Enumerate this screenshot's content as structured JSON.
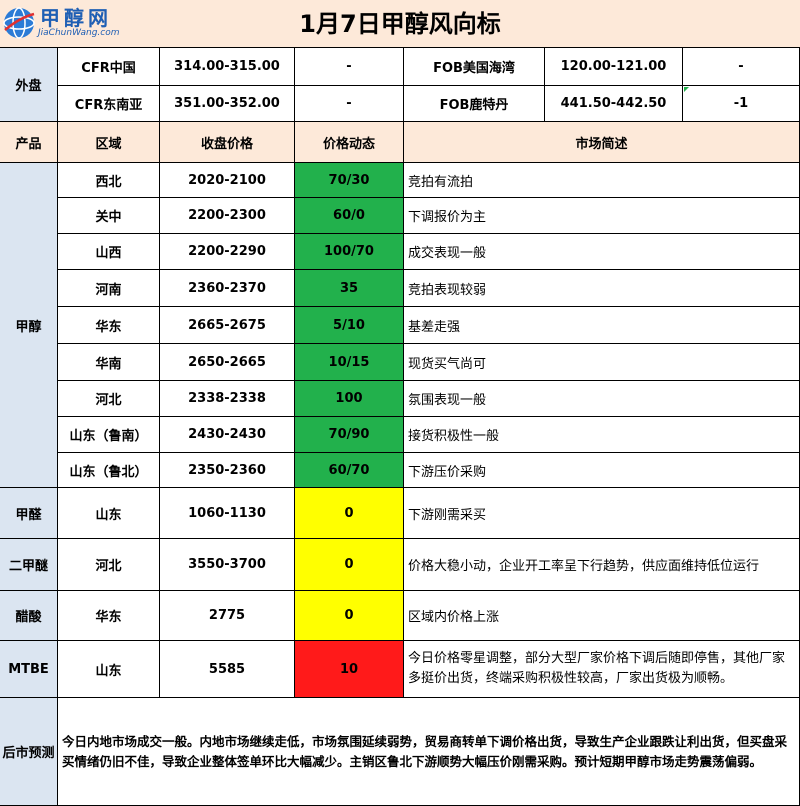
{
  "title_bar": {
    "logo_text": "甲醇网",
    "logo_url": "JiaChunWang.com",
    "title": "1月7日甲醇风向标"
  },
  "foreign": {
    "label": "外盘",
    "rows": [
      {
        "left_name": "CFR中国",
        "left_price": "314.00-315.00",
        "left_change": "-",
        "right_name": "FOB美国海湾",
        "right_price": "120.00-121.00",
        "right_change": "-"
      },
      {
        "left_name": "CFR东南亚",
        "left_price": "351.00-352.00",
        "left_change": "-",
        "right_name": "FOB鹿特丹",
        "right_price": "441.50-442.50",
        "right_change": "-1"
      }
    ]
  },
  "header": {
    "product": "产品",
    "region": "区域",
    "close_price": "收盘价格",
    "price_change": "价格动态",
    "market_desc": "市场简述"
  },
  "groups": [
    {
      "product": "甲醇",
      "rows": [
        {
          "region": "西北",
          "price": "2020-2100",
          "change": "70/30",
          "color": "#22b14c",
          "desc": "竞拍有流拍"
        },
        {
          "region": "关中",
          "price": "2200-2300",
          "change": "60/0",
          "color": "#22b14c",
          "desc": "下调报价为主"
        },
        {
          "region": "山西",
          "price": "2200-2290",
          "change": "100/70",
          "color": "#22b14c",
          "desc": "成交表现一般"
        },
        {
          "region": "河南",
          "price": "2360-2370",
          "change": "35",
          "color": "#22b14c",
          "desc": "竞拍表现较弱"
        },
        {
          "region": "华东",
          "price": "2665-2675",
          "change": "5/10",
          "color": "#22b14c",
          "desc": "基差走强"
        },
        {
          "region": "华南",
          "price": "2650-2665",
          "change": "10/15",
          "color": "#22b14c",
          "desc": "现货买气尚可"
        },
        {
          "region": "河北",
          "price": "2338-2338",
          "change": "100",
          "color": "#22b14c",
          "desc": "氛围表现一般"
        },
        {
          "region": "山东（鲁南）",
          "price": "2430-2430",
          "change": "70/90",
          "color": "#22b14c",
          "desc": "接货积极性一般"
        },
        {
          "region": "山东（鲁北）",
          "price": "2350-2360",
          "change": "60/70",
          "color": "#22b14c",
          "desc": "下游压价采购"
        }
      ]
    },
    {
      "product": "甲醛",
      "rows": [
        {
          "region": "山东",
          "price": "1060-1130",
          "change": "0",
          "color": "#ffff00",
          "desc": "下游刚需采买"
        }
      ]
    },
    {
      "product": "二甲醚",
      "rows": [
        {
          "region": "河北",
          "price": "3550-3700",
          "change": "0",
          "color": "#ffff00",
          "desc": "价格大稳小动，企业开工率呈下行趋势，供应面维持低位运行"
        }
      ]
    },
    {
      "product": "醋酸",
      "rows": [
        {
          "region": "华东",
          "price": "2775",
          "change": "0",
          "color": "#ffff00",
          "desc": "区域内价格上涨"
        }
      ]
    },
    {
      "product": "MTBE",
      "rows": [
        {
          "region": "山东",
          "price": "5585",
          "change": "10",
          "color": "#ff1a1a",
          "desc": "今日价格零星调整，部分大型厂家价格下调后随即停售，其他厂家多挺价出货，终端采购积极性较高，厂家出货极为顺畅。"
        }
      ]
    }
  ],
  "forecast": {
    "label": "后市预测",
    "text": "今日内地市场成交一般。内地市场继续走低，市场氛围延续弱势，贸易商转单下调价格出货，导致生产企业跟跌让利出货，但买盘采买情绪仍旧不佳，导致企业整体签单环比大幅减少。主销区鲁北下游顺势大幅压价刚需采购。预计短期甲醇市场走势震荡偏弱。"
  }
}
